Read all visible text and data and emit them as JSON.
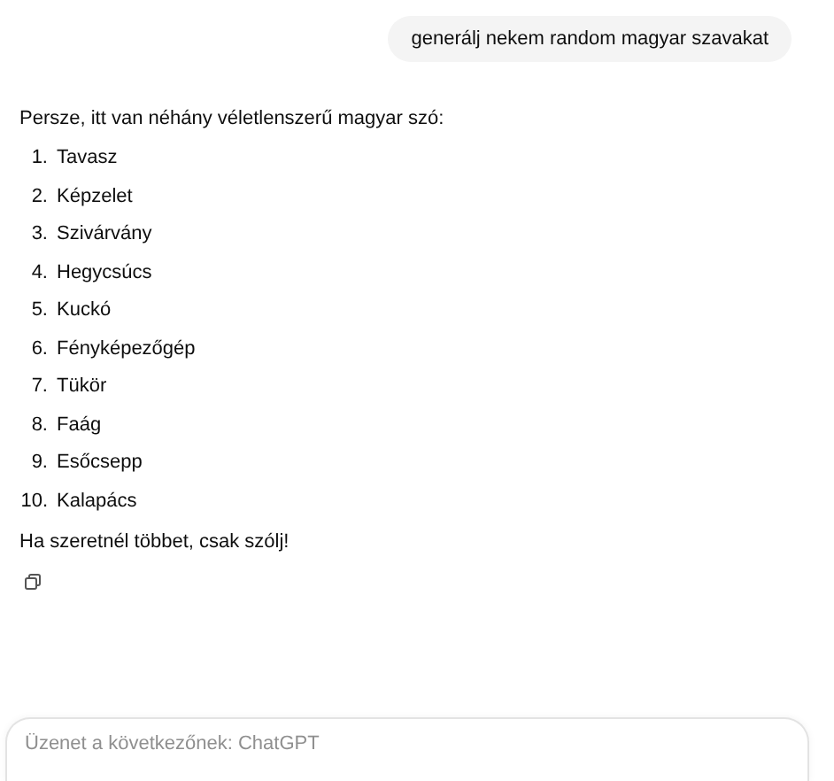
{
  "user_message": "generálj nekem random magyar szavakat",
  "reply": {
    "intro": "Persze, itt van néhány véletlenszerű magyar szó:",
    "items": [
      {
        "number": "1.",
        "word": "Tavasz"
      },
      {
        "number": "2.",
        "word": "Képzelet"
      },
      {
        "number": "3.",
        "word": "Szivárvány"
      },
      {
        "number": "4.",
        "word": "Hegycsúcs"
      },
      {
        "number": "5.",
        "word": "Kuckó"
      },
      {
        "number": "6.",
        "word": "Fényképezőgép"
      },
      {
        "number": "7.",
        "word": "Tükör"
      },
      {
        "number": "8.",
        "word": "Faág"
      },
      {
        "number": "9.",
        "word": "Esőcsepp"
      },
      {
        "number": "10.",
        "word": "Kalapács"
      }
    ],
    "closing": "Ha szeretnél többet, csak szólj!"
  },
  "composer": {
    "placeholder": "Üzenet a következőnek: ChatGPT"
  }
}
